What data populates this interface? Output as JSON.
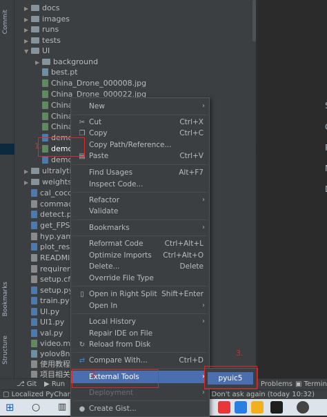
{
  "left_strip": {
    "commit": "Commit",
    "bookmarks": "Bookmarks",
    "structure": "Structure"
  },
  "tree": [
    {
      "label": "docs"
    },
    {
      "label": "images"
    },
    {
      "label": "runs"
    },
    {
      "label": "tests"
    },
    {
      "label": "UI"
    },
    {
      "label": "background"
    },
    {
      "label": "best.pt"
    },
    {
      "label": "China_Drone_000008.jpg"
    },
    {
      "label": "China_Drone_000022.jpg"
    },
    {
      "label": "China"
    },
    {
      "label": "China"
    },
    {
      "label": "China"
    },
    {
      "label": "demo"
    },
    {
      "label": "demo"
    },
    {
      "label": "demo"
    },
    {
      "label": "ultralytic"
    },
    {
      "label": "weights"
    },
    {
      "label": "cal_coco"
    },
    {
      "label": "commac"
    },
    {
      "label": "detect.py"
    },
    {
      "label": "get_FPS."
    },
    {
      "label": "hyp.yam"
    },
    {
      "label": "plot_resu"
    },
    {
      "label": "READMI"
    },
    {
      "label": "requiren"
    },
    {
      "label": "setup.cfg"
    },
    {
      "label": "setup.py"
    },
    {
      "label": "train.py"
    },
    {
      "label": "UI.py"
    },
    {
      "label": "UI1.py"
    },
    {
      "label": "val.py"
    },
    {
      "label": "video.mp"
    },
    {
      "label": "yolov8n"
    },
    {
      "label": "使用教程"
    },
    {
      "label": "项目相关"
    }
  ],
  "editor_letters": [
    "S",
    "C",
    "P",
    "N",
    "D"
  ],
  "menu": {
    "new": "New",
    "cut": "Cut",
    "cut_sc": "Ctrl+X",
    "copy": "Copy",
    "copy_sc": "Ctrl+C",
    "copy_path": "Copy Path/Reference...",
    "paste": "Paste",
    "paste_sc": "Ctrl+V",
    "find_usages": "Find Usages",
    "find_usages_sc": "Alt+F7",
    "inspect": "Inspect Code...",
    "refactor": "Refactor",
    "validate": "Validate",
    "bookmarks": "Bookmarks",
    "reformat": "Reformat Code",
    "reformat_sc": "Ctrl+Alt+L",
    "optimize": "Optimize Imports",
    "optimize_sc": "Ctrl+Alt+O",
    "delete": "Delete...",
    "delete_sc": "Delete",
    "override": "Override File Type",
    "open_right": "Open in Right Split",
    "open_right_sc": "Shift+Enter",
    "open_in": "Open In",
    "local_history": "Local History",
    "repair": "Repair IDE on File",
    "reload": "Reload from Disk",
    "compare": "Compare With...",
    "compare_sc": "Ctrl+D",
    "external_tools": "External Tools",
    "deployment": "Deployment",
    "create_gist": "Create Gist..."
  },
  "submenu": {
    "pyuic5": "pyuic5"
  },
  "annotations": {
    "one": "1.",
    "two": "2.",
    "three": "3."
  },
  "bottom_bar": {
    "git": "Git",
    "run": "Run",
    "problems": "Problems",
    "terminal": "Termin"
  },
  "status": {
    "left": "Localized PyCharm",
    "right": "/ Don't ask again (today 10:32)"
  },
  "colors": {
    "highlight": "#4b6eaf",
    "annotation": "#e0282a",
    "selection": "#0d293e"
  }
}
